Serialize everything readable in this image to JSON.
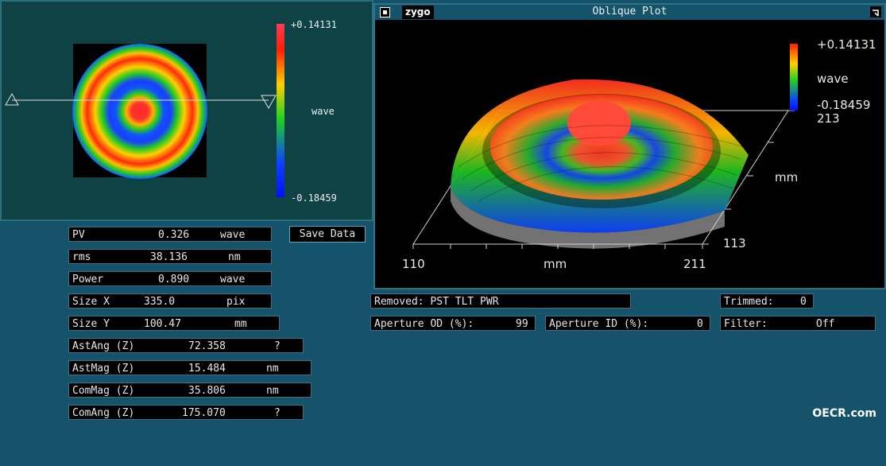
{
  "colorbar": {
    "max": "+0.14131",
    "min": "-0.18459",
    "unit": "wave"
  },
  "window": {
    "brand": "zygo",
    "title": "Oblique Plot"
  },
  "plot": {
    "colorbar_max": "+0.14131",
    "colorbar_unit": "wave",
    "colorbar_min": "-0.18459",
    "y_axis_max": "213",
    "y_axis_label": "mm",
    "y_axis_min": "113",
    "x_axis_min": "110",
    "x_axis_label": "mm",
    "x_axis_max": "211"
  },
  "stats": [
    {
      "name": "PV",
      "value": "0.326",
      "unit": "wave"
    },
    {
      "name": "rms",
      "value": "38.136",
      "unit": "nm"
    },
    {
      "name": "Power",
      "value": "0.890",
      "unit": "wave"
    },
    {
      "name": "Size X",
      "value": "335.0",
      "unit": "pix"
    },
    {
      "name": "Size Y",
      "value": "100.47",
      "unit": "mm"
    },
    {
      "name": "AstAng (Z)",
      "value": "72.358",
      "unit": "?"
    },
    {
      "name": "AstMag (Z)",
      "value": "15.484",
      "unit": "nm"
    },
    {
      "name": "ComMag (Z)",
      "value": "35.806",
      "unit": "nm"
    },
    {
      "name": "ComAng (Z)",
      "value": "175.070",
      "unit": "?"
    }
  ],
  "buttons": {
    "save_data": "Save Data"
  },
  "info": {
    "removed": "Removed: PST TLT PWR",
    "trimmed_label": "Trimmed:",
    "trimmed_value": "0",
    "aperture_od_label": "Aperture OD (%):",
    "aperture_od_value": "99",
    "aperture_id_label": "Aperture ID (%):",
    "aperture_id_value": "0",
    "filter_label": "Filter:",
    "filter_value": "Off"
  },
  "watermark": "OECR.com",
  "colors": {
    "panel_bg": "#15536a",
    "map_bg": "#0f4244",
    "field_bg": "#000000"
  }
}
